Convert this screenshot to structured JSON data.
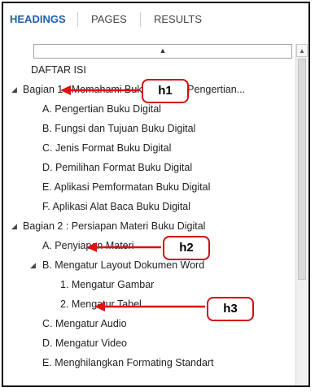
{
  "tabs": [
    {
      "label": "HEADINGS",
      "active": true
    },
    {
      "label": "PAGES",
      "active": false
    },
    {
      "label": "RESULTS",
      "active": false
    }
  ],
  "collapse_all_icon": "collapse-all-icon",
  "items": [
    {
      "text": "DAFTAR ISI",
      "level": 0
    },
    {
      "text": "Bagian 1 : Memahami Buku Digital : Pengertian...",
      "level": 0,
      "expanded": true
    },
    {
      "text": "A. Pengertian Buku Digital",
      "level": 1
    },
    {
      "text": "B. Fungsi dan Tujuan Buku Digital",
      "level": 1
    },
    {
      "text": "C. Jenis Format Buku Digital",
      "level": 1
    },
    {
      "text": "D. Pemilihan Format Buku Digital",
      "level": 1
    },
    {
      "text": "E. Aplikasi Pemformatan Buku Digital",
      "level": 1
    },
    {
      "text": "F. Aplikasi Alat Baca Buku Digital",
      "level": 1
    },
    {
      "text": "Bagian 2 : Persiapan Materi Buku Digital",
      "level": 0,
      "expanded": true
    },
    {
      "text": "A. Penyiapan Materi",
      "level": 1
    },
    {
      "text": "B. Mengatur Layout Dokumen Word",
      "level": 1,
      "expanded": true
    },
    {
      "text": "1. Mengatur Gambar",
      "level": 2
    },
    {
      "text": "2. Mengatur Tabel",
      "level": 2
    },
    {
      "text": "C. Mengatur Audio",
      "level": 1
    },
    {
      "text": "D. Mengatur Video",
      "level": 1
    },
    {
      "text": "E. Menghilangkan Formating Standart",
      "level": 1
    }
  ],
  "callouts": [
    {
      "label": "h1"
    },
    {
      "label": "h2"
    },
    {
      "label": "h3"
    }
  ],
  "colors": {
    "active_tab": "#1f5fa8",
    "callout_border": "#d01010",
    "arrow": "#e01010"
  }
}
